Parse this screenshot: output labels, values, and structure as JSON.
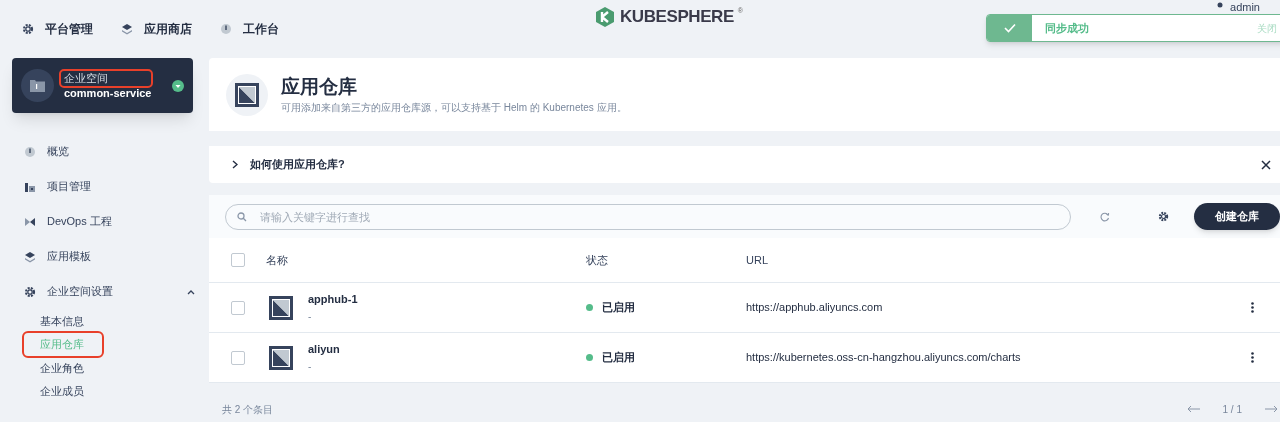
{
  "top_nav": [
    {
      "kind": "gear",
      "label": "平台管理"
    },
    {
      "kind": "layers",
      "label": "应用商店"
    },
    {
      "kind": "gauge",
      "label": "工作台"
    }
  ],
  "logo": {
    "text": "KUBESPHERE",
    "mark": "®"
  },
  "user": {
    "name": "admin"
  },
  "toast": {
    "message": "同步成功",
    "close": "关闭"
  },
  "workspace": {
    "label": "企业空间",
    "name": "common-service",
    "label_highlighted": true
  },
  "sidebar": {
    "items": [
      {
        "kind": "gauge",
        "label": "概览"
      },
      {
        "kind": "bars",
        "label": "项目管理"
      },
      {
        "kind": "devops",
        "label": "DevOps 工程"
      },
      {
        "kind": "layers",
        "label": "应用模板"
      },
      {
        "kind": "gear",
        "label": "企业空间设置",
        "expanded": true,
        "children": [
          {
            "label": "基本信息",
            "selected": false,
            "highlighted": false
          },
          {
            "label": "应用仓库",
            "selected": true,
            "highlighted": true
          },
          {
            "label": "企业角色",
            "selected": false,
            "highlighted": false
          },
          {
            "label": "企业成员",
            "selected": false,
            "highlighted": false
          }
        ]
      }
    ]
  },
  "page": {
    "title": "应用仓库",
    "description": "可用添加来自第三方的应用仓库源，可以支持基于 Helm 的 Kubernetes 应用。",
    "help": "如何使用应用仓库?"
  },
  "search": {
    "placeholder": "请输入关键字进行查找"
  },
  "create_button": "创建仓库",
  "table": {
    "select_all_checked": false,
    "columns": [
      "名称",
      "状态",
      "URL"
    ],
    "rows": [
      {
        "name": "apphub-1",
        "description": "-",
        "status": "已启用",
        "color": "#55bc8a",
        "url": "https://apphub.aliyuncs.com",
        "checked": false
      },
      {
        "name": "aliyun",
        "description": "-",
        "status": "已启用",
        "color": "#55bc8a",
        "url": "https://kubernetes.oss-cn-hangzhou.aliyuncs.com/charts",
        "checked": false
      }
    ]
  },
  "footer": {
    "total": "共 2 个条目",
    "page": "1 / 1"
  }
}
